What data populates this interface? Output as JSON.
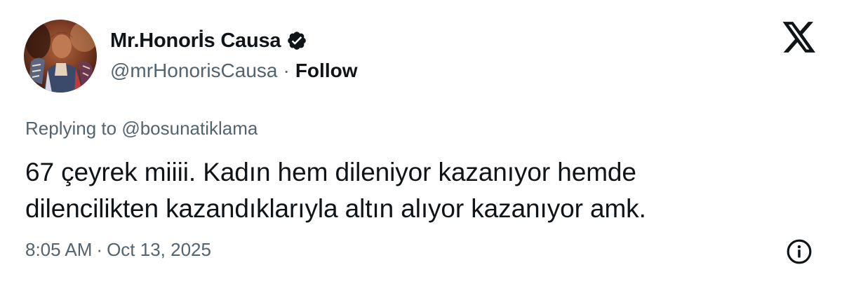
{
  "author": {
    "display_name": "Mr.Honorİs Causa",
    "handle": "@mrHonorisCausa",
    "separator": "·",
    "follow_label": "Follow",
    "verified_icon": "verified-badge-icon"
  },
  "brand": {
    "logo_icon": "x-logo-icon"
  },
  "reply": {
    "prefix": "Replying to",
    "target": "@bosunatiklama"
  },
  "tweet": {
    "text_lines": [
      "67 çeyrek miiii. Kadın hem dileniyor kazanıyor hemde",
      "dilencilikten kazandıklarıyla altın alıyor kazanıyor amk."
    ]
  },
  "meta": {
    "time": "8:05 AM",
    "separator": "·",
    "date": "Oct 13, 2025",
    "info_icon": "info-icon"
  },
  "colors": {
    "text_primary": "#0f1419",
    "text_secondary": "#536471",
    "background": "#ffffff"
  }
}
